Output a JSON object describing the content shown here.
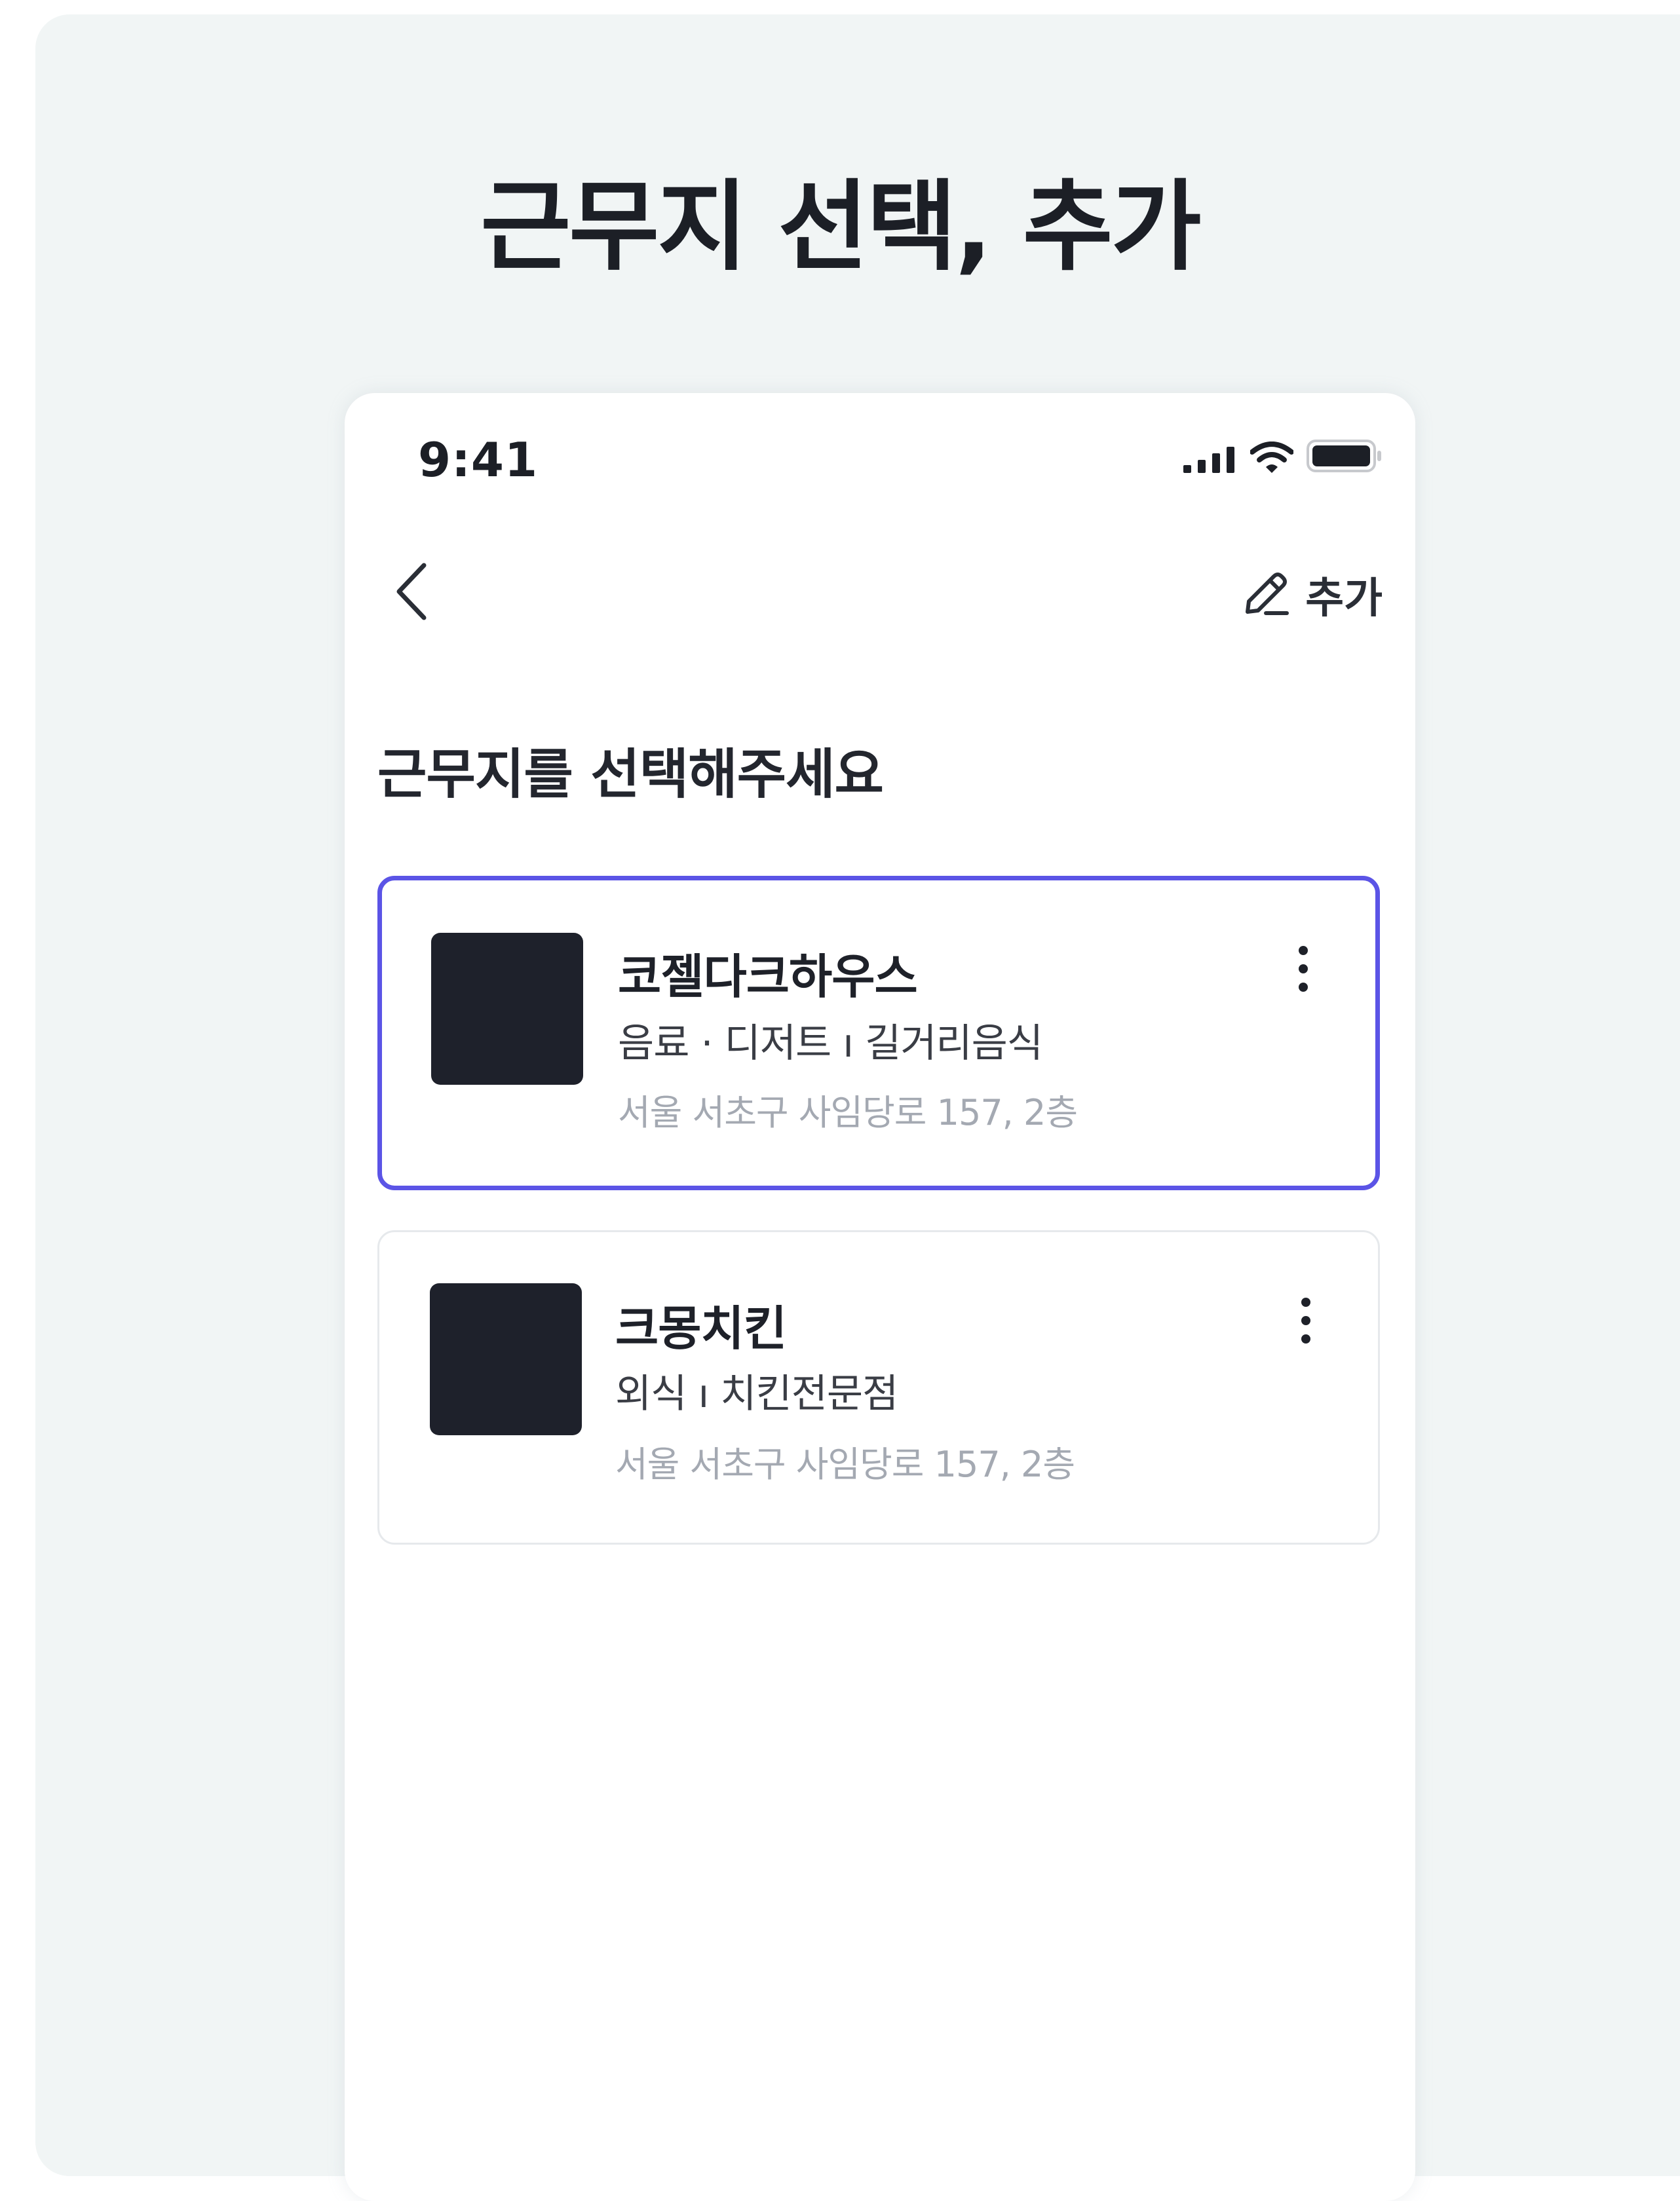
{
  "page": {
    "title": "근무지 선택, 추가"
  },
  "status_bar": {
    "time": "9:41",
    "icons": [
      "cellular-signal-icon",
      "wifi-icon",
      "battery-icon"
    ]
  },
  "nav": {
    "back_icon": "chevron-left-icon",
    "add_icon": "pencil-icon",
    "add_label": "추가"
  },
  "content": {
    "heading": "근무지를 선택해주세요",
    "workplaces": [
      {
        "name": "코젤다크하우스",
        "category": "음료 · 디저트 ı 길거리음식",
        "address": "서울 서초구 사임당로 157, 2층",
        "selected": true
      },
      {
        "name": "크몽치킨",
        "category": "외식 ı 치킨전문점",
        "address": "서울 서초구 사임당로 157, 2층",
        "selected": false
      }
    ]
  },
  "colors": {
    "background": "#f1f5f5",
    "accent": "#5b54e6",
    "text_primary": "#1e2129",
    "text_muted": "#a4a9b2",
    "thumbnail": "#1e212b"
  }
}
